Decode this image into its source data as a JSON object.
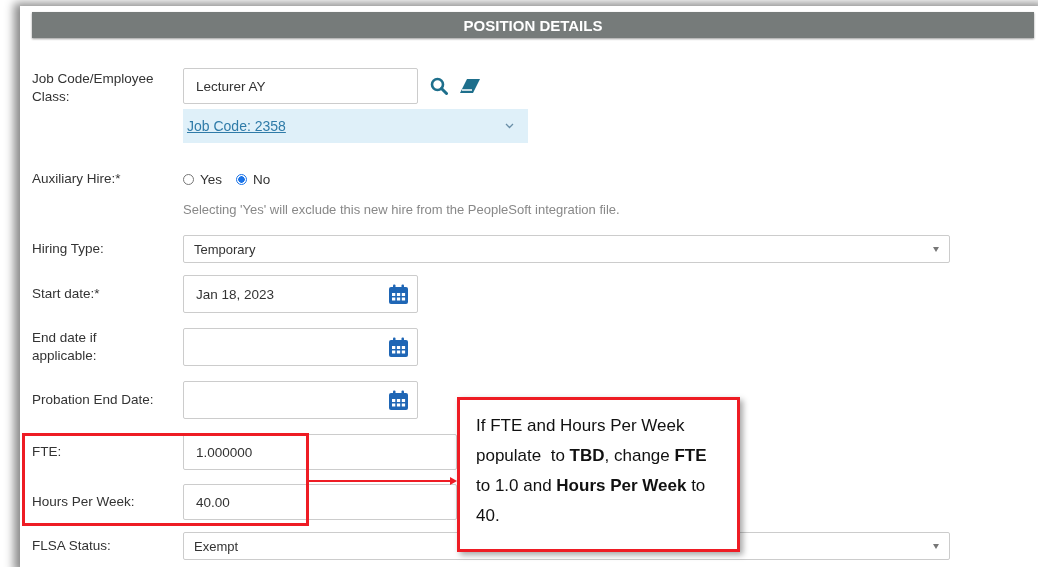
{
  "section": {
    "title": "POSITION DETAILS"
  },
  "fields": [
    {
      "kind": "lookup",
      "label": "Job Code/Employee Class:",
      "value": "Lecturer AY",
      "link": "Job Code: 2358"
    },
    {
      "kind": "radio",
      "label": "Auxiliary Hire:*",
      "options": [
        {
          "label": "Yes",
          "selected": false
        },
        {
          "label": "No",
          "selected": true
        }
      ],
      "hint": "Selecting 'Yes' will exclude this new hire from the PeopleSoft integration file."
    },
    {
      "kind": "select",
      "label": "Hiring Type:",
      "value": "Temporary"
    },
    {
      "kind": "date",
      "label": "Start date:*",
      "value": "Jan 18, 2023"
    },
    {
      "kind": "date",
      "label": "End date if applicable:"
    },
    {
      "kind": "date",
      "label": "Probation End Date:"
    },
    {
      "kind": "text",
      "label": "FTE:",
      "value": "1.000000"
    },
    {
      "kind": "text",
      "label": "Hours Per Week:",
      "value": "40.00"
    },
    {
      "kind": "select",
      "label": "FLSA Status:",
      "value": "Exempt"
    }
  ],
  "callout": {
    "text": "If FTE and Hours Per Week populate  to **TBD**, change **FTE** to 1.0 and **Hours Per Week** to 40."
  }
}
